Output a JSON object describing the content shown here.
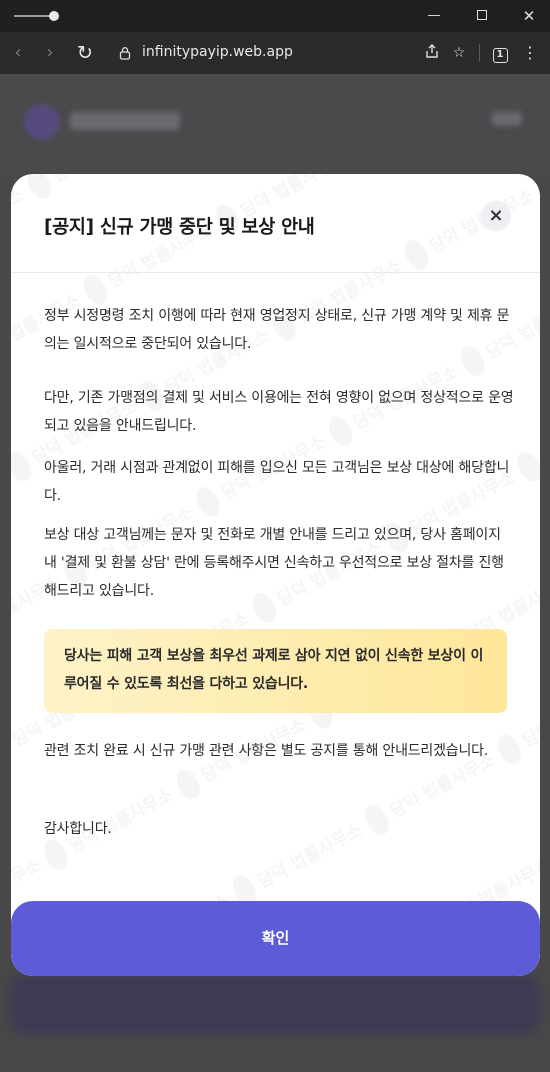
{
  "browser": {
    "url": "infinitypayip.web.app",
    "tab_count": "1"
  },
  "modal": {
    "title": "[공지] 신규 가맹 중단 및 보상 안내",
    "close_label": "×",
    "paragraphs": [
      "정부 시정명령 조치 이행에 따라 현재 영업정지 상태로, 신규 가맹 계약 및 제휴 문의는 일시적으로 중단되어 있습니다.",
      "다만, 기존 가맹점의 결제 및 서비스 이용에는 전혀 영향이 없으며 정상적으로 운영되고 있음을 안내드립니다.",
      "아울러, 거래 시점과 관계없이 피해를 입으신 모든 고객님은 보상 대상에 해당합니다.",
      "보상 대상 고객님께는 문자 및 전화로 개별 안내를 드리고 있으며, 당사 홈페이지 내 '결제 및 환불 상담' 란에 등록해주시면 신속하고 우선적으로 보상 절차를 진행해드리고 있습니다.",
      "관련 조치 완료 시 신규 가맹 관련 사항은 별도 공지를 통해 안내드리겠습니다.",
      "감사합니다."
    ],
    "highlight": "당사는 피해 고객 보상을 최우선 과제로 삼아 지연 없이 신속한 보상이 이루어질 수 있도록 최선을 다하고 있습니다.",
    "confirm_label": "확인"
  },
  "watermark": {
    "text": "담덕 법률사무소"
  },
  "colors": {
    "accent": "#5d5bd8",
    "highlight_start": "#fdf3c8",
    "highlight_end": "#ffe79a"
  }
}
